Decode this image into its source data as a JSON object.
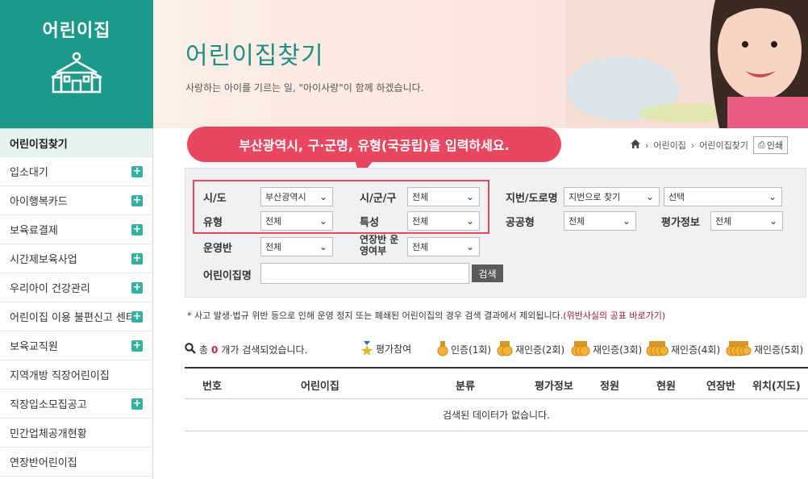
{
  "sidebar": {
    "title": "어린이집",
    "items": [
      {
        "label": "어린이집찾기",
        "expandable": false
      },
      {
        "label": "입소대기",
        "expandable": true
      },
      {
        "label": "아이행복카드",
        "expandable": true
      },
      {
        "label": "보육료결제",
        "expandable": true
      },
      {
        "label": "시간제보육사업",
        "expandable": true
      },
      {
        "label": "우리아이 건강관리",
        "expandable": true
      },
      {
        "label": "어린이집 이용 불편신고 센터",
        "expandable": true
      },
      {
        "label": "보육교직원",
        "expandable": true
      },
      {
        "label": "지역개방 직장어린이집",
        "expandable": false
      },
      {
        "label": "직장입소모집공고",
        "expandable": true
      },
      {
        "label": "민간업체공개현황",
        "expandable": false
      },
      {
        "label": "연장반어린이집",
        "expandable": false
      }
    ]
  },
  "banner": {
    "title": "어린이집찾기",
    "subtitle": "사랑하는 아이를 기르는 일, \"아이사랑\"이 함께 하겠습니다."
  },
  "callout": {
    "text": "부산광역시, 구·군명, 유형(국공립)을 입력하세요."
  },
  "breadcrumb": {
    "items": [
      "어린이집",
      "어린이집찾기"
    ],
    "print_label": "인쇄"
  },
  "search": {
    "sido_label": "시/도",
    "sido_value": "부산광역시",
    "sigungu_label": "시/군/구",
    "sigungu_value": "전체",
    "jibun_label": "지번/도로명",
    "jibun_value": "지번으로 찾기",
    "jibun_select_value": "선택",
    "type_label": "유형",
    "type_value": "전체",
    "feature_label": "특성",
    "feature_value": "전체",
    "public_label": "공공형",
    "public_value": "전체",
    "eval_label": "평가정보",
    "eval_value": "전체",
    "class_label": "운영반",
    "class_value": "전체",
    "extended_label": "연장반 운영여부",
    "extended_value": "전체",
    "name_label": "어린이집명",
    "name_value": "",
    "search_button": "검색"
  },
  "notice": {
    "text": "* 사고 발생·법규 위반 등으로 인해 운영 정지 또는 폐쇄된 어린이집의 경우 검색 결과에서 제외됩니다.",
    "link": "(위반사실의 공표 바로가기)"
  },
  "results": {
    "prefix": "총",
    "count": "0",
    "suffix": "개가 검색되었습니다."
  },
  "legend": {
    "items": [
      "평가참여",
      "인증(1회)",
      "재인증(2회)",
      "재인증(3회)",
      "재인증(4회)",
      "재인증(5회)"
    ]
  },
  "table": {
    "headers": [
      "번호",
      "어린이집",
      "분류",
      "평가정보",
      "정원",
      "현원",
      "연장반",
      "위치(지도)"
    ],
    "empty_message": "검색된 데이터가 없습니다."
  },
  "colors": {
    "brand_teal": "#1b9a8c",
    "callout_red": "#e8475f",
    "count_red": "#d21f3c"
  }
}
